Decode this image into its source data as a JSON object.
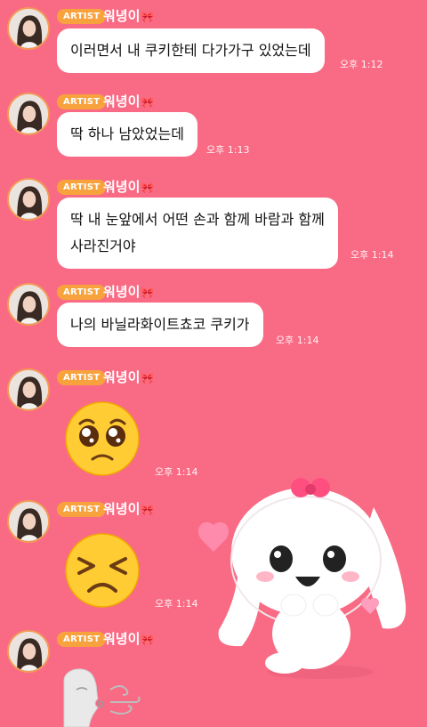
{
  "chat": {
    "artist_badge": "ARTIST",
    "sender_name": "워녕이",
    "messages": [
      {
        "text": "이러면서 내 쿠키한테 다가가구 있었는데",
        "time": "오후 1:12"
      },
      {
        "text": "딱 하나 남았었는데",
        "time": "오후 1:13"
      },
      {
        "text_line1": "딱 내 눈앞에서 어떤 손과 함께 바람과 함께",
        "text_line2": "사라진거야",
        "time": "오후 1:14"
      },
      {
        "text": "나의 바닐라화이트쵸코 쿠키가",
        "time": "오후 1:14"
      },
      {
        "emoji": "pleading-face-emoji",
        "time": "오후 1:14"
      },
      {
        "emoji": "persevering-face-emoji",
        "time": "오후 1:14"
      },
      {
        "sticker": "blowing-wind-sticker"
      }
    ]
  },
  "decorations": {
    "mascot": "white-bunny-mascot-with-hearts",
    "bow_icon": "pink-bow-icon"
  },
  "colors": {
    "background": "#f96b85",
    "badge": "#f7a23d",
    "avatar_ring": "#f39a57",
    "bubble": "#ffffff"
  }
}
